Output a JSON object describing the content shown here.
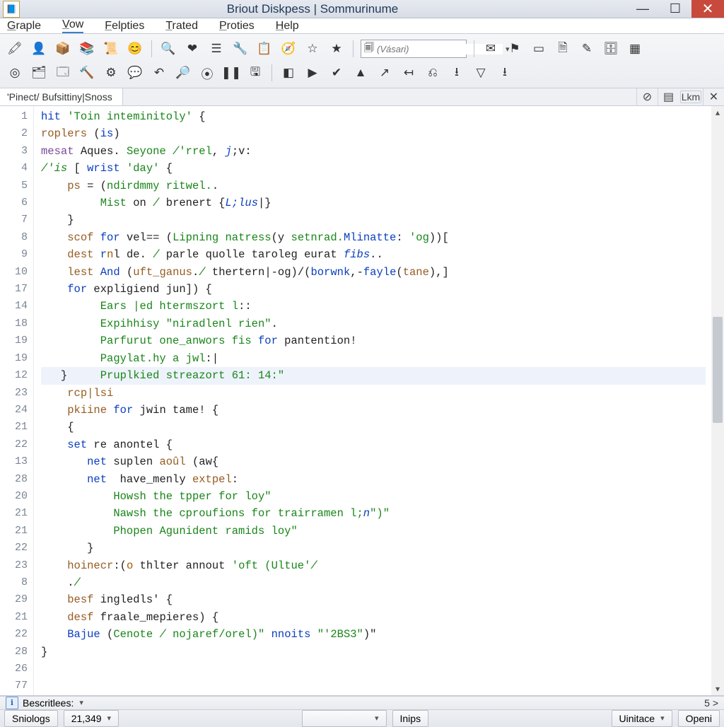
{
  "title": "Briout Diskpess | Sommurinume",
  "menus": [
    "Graple",
    "Vow",
    "Felpties",
    "Trated",
    "Proties",
    "Help"
  ],
  "active_menu_index": 1,
  "toolbar1": [
    {
      "name": "marker-icon",
      "glyph": "🖍"
    },
    {
      "name": "user-icon",
      "glyph": "👤"
    },
    {
      "name": "box-icon",
      "glyph": "📦"
    },
    {
      "name": "books-icon",
      "glyph": "📚"
    },
    {
      "name": "scroll-icon",
      "glyph": "📜"
    },
    {
      "name": "face-icon",
      "glyph": "😊"
    },
    {
      "name": "",
      "glyph": "|",
      "sep": true
    },
    {
      "name": "zoom-icon",
      "glyph": "🔍"
    },
    {
      "name": "heart-icon",
      "glyph": "❤"
    },
    {
      "name": "list-icon",
      "glyph": "☰"
    },
    {
      "name": "wrench-icon",
      "glyph": "🔧"
    },
    {
      "name": "paste-icon",
      "glyph": "📋"
    },
    {
      "name": "compass-icon",
      "glyph": "🧭"
    },
    {
      "name": "star-outline-icon",
      "glyph": "☆"
    },
    {
      "name": "star-icon",
      "glyph": "★"
    }
  ],
  "search_placeholder": "(Vásari)",
  "toolbar1b": [
    {
      "name": "mail-icon",
      "glyph": "✉"
    },
    {
      "name": "flag-icon",
      "glyph": "⚑"
    },
    {
      "name": "note-icon",
      "glyph": "▭"
    },
    {
      "name": "document-icon",
      "glyph": "🗎"
    },
    {
      "name": "pencil-icon",
      "glyph": "✎"
    },
    {
      "name": "stamp-icon",
      "glyph": "🗄"
    },
    {
      "name": "grid-icon",
      "glyph": "▦"
    }
  ],
  "toolbar2": [
    {
      "name": "target-icon",
      "glyph": "◎"
    },
    {
      "name": "stack-icon",
      "glyph": "🗂"
    },
    {
      "name": "window-icon",
      "glyph": "🗔"
    },
    {
      "name": "hammer-icon",
      "glyph": "🔨"
    },
    {
      "name": "gear-icon",
      "glyph": "⚙"
    },
    {
      "name": "chat-icon",
      "glyph": "💬"
    },
    {
      "name": "undo-icon",
      "glyph": "↶"
    },
    {
      "name": "find-icon",
      "glyph": "🔎"
    },
    {
      "name": "record-icon",
      "glyph": "⦿"
    },
    {
      "name": "pause-icon",
      "glyph": "❚❚"
    },
    {
      "name": "save-icon",
      "glyph": "🖫"
    },
    {
      "name": "",
      "glyph": "|",
      "sep": true
    },
    {
      "name": "panel-icon",
      "glyph": "◧"
    },
    {
      "name": "play-icon",
      "glyph": "▶"
    },
    {
      "name": "check-icon",
      "glyph": "✔"
    },
    {
      "name": "up-icon",
      "glyph": "▲"
    },
    {
      "name": "share-icon",
      "glyph": "↗"
    },
    {
      "name": "back-icon",
      "glyph": "↤"
    },
    {
      "name": "link-icon",
      "glyph": "⎌"
    },
    {
      "name": "download-icon",
      "glyph": "⭳"
    },
    {
      "name": "filter-icon",
      "glyph": "▽"
    },
    {
      "name": "import-icon",
      "glyph": "⭳"
    }
  ],
  "tab_label": "'Pinect/ Bufsittiny|Snoss",
  "tab_right": [
    {
      "name": "target-tab-icon",
      "glyph": "⊘"
    },
    {
      "name": "bars-tab-icon",
      "glyph": "▤"
    }
  ],
  "tab_lkm": "Lkm",
  "gutter": [
    "1",
    "2",
    "3",
    "4",
    "5",
    "6",
    "7",
    "8",
    "9",
    "10",
    "17",
    "14",
    "18",
    "19",
    "19",
    "12",
    "23",
    "24",
    "21",
    "22",
    "13",
    "28",
    "20",
    "21",
    "21",
    "22",
    "23",
    "8",
    "29",
    "21",
    "22",
    "28",
    "26",
    "77"
  ],
  "code": [
    {
      "t": [
        [
          "kw",
          "hit "
        ],
        [
          "s",
          "'Toin inteminitoly'"
        ],
        [
          "nm",
          " {"
        ]
      ]
    },
    {
      "t": [
        [
          "id",
          "roplers"
        ],
        [
          "nm",
          " ("
        ],
        [
          "kw",
          "is"
        ],
        [
          "nm",
          ")"
        ]
      ]
    },
    {
      "t": [
        [
          "ty",
          "mesat"
        ],
        [
          "nm",
          " Aques. "
        ],
        [
          "s",
          "Seyone "
        ],
        [
          "cm",
          "/"
        ],
        [
          "s",
          "'rrel"
        ],
        [
          "nm",
          ", "
        ],
        [
          "kwi",
          "j"
        ],
        [
          "nm",
          ";v:"
        ]
      ]
    },
    {
      "t": [
        [
          "nm",
          ""
        ]
      ]
    },
    {
      "t": [
        [
          "cm",
          "/'is"
        ],
        [
          "nm",
          " [ "
        ],
        [
          "kw",
          "wrist "
        ],
        [
          "s",
          "'day'"
        ],
        [
          "nm",
          " {"
        ]
      ]
    },
    {
      "t": [
        [
          "nm",
          "    "
        ],
        [
          "id",
          "ps"
        ],
        [
          "nm",
          " = ("
        ],
        [
          "s",
          "ndirdmmy ritwel."
        ],
        [
          "nm",
          "."
        ]
      ]
    },
    {
      "t": [
        [
          "nm",
          "         "
        ],
        [
          "s",
          "Mist"
        ],
        [
          "nm",
          " on "
        ],
        [
          "cm",
          "/"
        ],
        [
          "nm",
          " brenert {"
        ],
        [
          "kwi",
          "L;lus"
        ],
        [
          "nm",
          "|}"
        ]
      ]
    },
    {
      "t": [
        [
          "nm",
          "    }"
        ]
      ]
    },
    {
      "t": [
        [
          "nm",
          "    "
        ],
        [
          "id",
          "scof"
        ],
        [
          "nm",
          " "
        ],
        [
          "kw",
          "for"
        ],
        [
          "nm",
          " vel== ("
        ],
        [
          "s",
          "Lipning natress"
        ],
        [
          "nm",
          "(y "
        ],
        [
          "s",
          "setnrad."
        ],
        [
          "kw",
          "Mlinatte"
        ],
        [
          "nm",
          ": "
        ],
        [
          "s",
          "'og"
        ],
        [
          "nm",
          "))["
        ]
      ]
    },
    {
      "t": [
        [
          "nm",
          "    "
        ],
        [
          "id",
          "dest"
        ],
        [
          "nm",
          " "
        ],
        [
          "kw",
          "r"
        ],
        [
          "num",
          "n"
        ],
        [
          "nm",
          "l de. "
        ],
        [
          "cm",
          "/"
        ],
        [
          "nm",
          " parle quolle taroleg eurat "
        ],
        [
          "kwi",
          "fibs"
        ],
        [
          "nm",
          ".."
        ]
      ]
    },
    {
      "t": [
        [
          "nm",
          "    "
        ],
        [
          "id",
          "lest"
        ],
        [
          "nm",
          " "
        ],
        [
          "kw",
          "And"
        ],
        [
          "nm",
          " ("
        ],
        [
          "id",
          "uft_ganus"
        ],
        [
          "nm",
          "."
        ],
        [
          "cm",
          "/"
        ],
        [
          "nm",
          " therter"
        ],
        [
          "nm",
          "n|-og)/("
        ],
        [
          "fn",
          "borwnk"
        ],
        [
          "nm",
          ",-"
        ],
        [
          "fn",
          "fayle"
        ],
        [
          "nm",
          "("
        ],
        [
          "id",
          "tane"
        ],
        [
          "nm",
          "),]"
        ]
      ]
    },
    {
      "t": [
        [
          "nm",
          ""
        ]
      ]
    },
    {
      "t": [
        [
          "nm",
          "    "
        ],
        [
          "kw",
          "for"
        ],
        [
          "nm",
          " expligiend jun]) {"
        ]
      ]
    },
    {
      "t": [
        [
          "nm",
          "         "
        ],
        [
          "s",
          "Ears |ed htermszort l"
        ],
        [
          "nm",
          "::"
        ]
      ]
    },
    {
      "t": [
        [
          "nm",
          "         "
        ],
        [
          "s",
          "Expihhisy "
        ],
        [
          "s",
          "\"niradlenl rien\""
        ],
        [
          "nm",
          "."
        ]
      ]
    },
    {
      "t": [
        [
          "nm",
          "         "
        ],
        [
          "s",
          "Parfurut one_anwors fis"
        ],
        [
          "nm",
          " "
        ],
        [
          "kw",
          "for"
        ],
        [
          "nm",
          " pantention!"
        ]
      ]
    },
    {
      "t": [
        [
          "nm",
          "         "
        ],
        [
          "s",
          "Pagylat.hy a jwl"
        ],
        [
          "nm",
          ":|"
        ]
      ]
    },
    {
      "hl": true,
      "t": [
        [
          "nm",
          "   }     "
        ],
        [
          "s",
          "Pruplkied streazort 61: 14:\""
        ]
      ]
    },
    {
      "t": [
        [
          "nm",
          "    "
        ],
        [
          "id",
          "rcp|lsi"
        ]
      ]
    },
    {
      "t": [
        [
          "nm",
          "    "
        ],
        [
          "id",
          "pkiine"
        ],
        [
          "nm",
          " "
        ],
        [
          "kw",
          "for"
        ],
        [
          "nm",
          " jwin tame! {"
        ]
      ]
    },
    {
      "t": [
        [
          "nm",
          "    {"
        ]
      ]
    },
    {
      "t": [
        [
          "nm",
          "    "
        ],
        [
          "kw",
          "set"
        ],
        [
          "nm",
          " re anontel {"
        ]
      ]
    },
    {
      "t": [
        [
          "nm",
          "       "
        ],
        [
          "kw",
          "net"
        ],
        [
          "nm",
          " suplen "
        ],
        [
          "id",
          "aoûl"
        ],
        [
          "nm",
          " (aw{"
        ]
      ]
    },
    {
      "t": [
        [
          "nm",
          "       "
        ],
        [
          "kw",
          "net"
        ],
        [
          "nm",
          "  have_menly "
        ],
        [
          "id",
          "extpel"
        ],
        [
          "nm",
          ":"
        ]
      ]
    },
    {
      "t": [
        [
          "nm",
          "           "
        ],
        [
          "s",
          "Howsh the tpper for loy\""
        ]
      ]
    },
    {
      "t": [
        [
          "nm",
          "           "
        ],
        [
          "s",
          "Nawsh the cproufions for trairramen l;"
        ],
        [
          "kwi",
          "n"
        ],
        [
          "s",
          "\")\""
        ]
      ]
    },
    {
      "t": [
        [
          "nm",
          "           "
        ],
        [
          "s",
          "Phopen Agunident ramids loy\""
        ]
      ]
    },
    {
      "t": [
        [
          "nm",
          "       }"
        ]
      ]
    },
    {
      "t": [
        [
          "nm",
          "    "
        ],
        [
          "id",
          "hoinecr"
        ],
        [
          "nm",
          ":("
        ],
        [
          "num",
          "o"
        ],
        [
          "nm",
          " thlter annout "
        ],
        [
          "s",
          "'oft (Ultue'"
        ],
        [
          "cm",
          "/"
        ]
      ]
    },
    {
      "t": [
        [
          "nm",
          "    ."
        ],
        [
          "cm",
          "/"
        ]
      ]
    },
    {
      "t": [
        [
          "nm",
          "    "
        ],
        [
          "id",
          "besf"
        ],
        [
          "nm",
          " ingledls' {"
        ]
      ]
    },
    {
      "t": [
        [
          "nm",
          "    "
        ],
        [
          "id",
          "desf"
        ],
        [
          "nm",
          " fraale_mepieres) {"
        ]
      ]
    },
    {
      "t": [
        [
          "nm",
          "    "
        ],
        [
          "fn",
          "Bajue"
        ],
        [
          "nm",
          " ("
        ],
        [
          "s",
          "Cenote "
        ],
        [
          "cm",
          "/"
        ],
        [
          "s",
          " nojaref/orel)\""
        ],
        [
          "nm",
          " "
        ],
        [
          "kw",
          "nnoits"
        ],
        [
          "nm",
          " "
        ],
        [
          "s",
          "\"'2BS3\""
        ],
        [
          "nm",
          ")\""
        ]
      ]
    },
    {
      "t": [
        [
          "nm",
          "}"
        ]
      ]
    }
  ],
  "bottombar_label": "Bescritlees:",
  "bottombar_right": "5 >",
  "status": {
    "left1": "Sniologs",
    "left2": "21,349",
    "mid_blank": "",
    "mid_label": "Inips",
    "right1": "Uinitace",
    "right2": "Openi"
  }
}
